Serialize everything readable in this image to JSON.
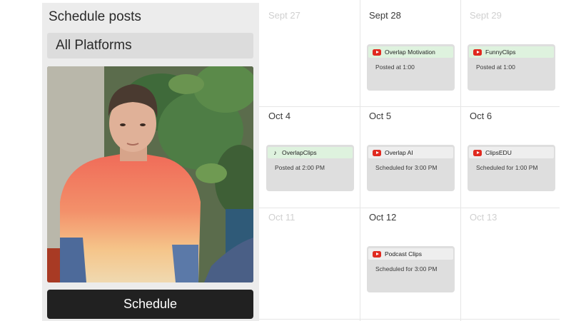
{
  "panel": {
    "title": "Schedule posts",
    "platform_select": "All Platforms",
    "schedule_button": "Schedule"
  },
  "calendar": {
    "days": [
      {
        "label": "Sept 27",
        "muted": true,
        "posts": []
      },
      {
        "label": "Sept 28",
        "muted": false,
        "posts": [
          {
            "platform_icon": "youtube-icon",
            "name": "Overlap Motivation",
            "status": "Posted at 1:00",
            "header_color": "#def2de"
          }
        ]
      },
      {
        "label": "Sept 29",
        "muted": true,
        "posts": [
          {
            "platform_icon": "youtube-icon",
            "name": "FunnyClips",
            "status": "Posted at 1:00",
            "header_color": "#def2de"
          }
        ]
      },
      {
        "label": "Oct 4",
        "muted": false,
        "posts": [
          {
            "platform_icon": "tiktok-icon",
            "name": "OverlapClips",
            "status": "Posted at 2:00 PM",
            "header_color": "#def2de"
          }
        ]
      },
      {
        "label": "Oct 5",
        "muted": false,
        "posts": [
          {
            "platform_icon": "youtube-icon",
            "name": "Overlap AI",
            "status": "Scheduled for 3:00 PM",
            "header_color": "#eeeeee"
          }
        ]
      },
      {
        "label": "Oct 6",
        "muted": false,
        "posts": [
          {
            "platform_icon": "youtube-icon",
            "name": "ClipsEDU",
            "status": "Scheduled for 1:00 PM",
            "header_color": "#eeeeee"
          }
        ]
      },
      {
        "label": "Oct 11",
        "muted": true,
        "posts": []
      },
      {
        "label": "Oct 12",
        "muted": false,
        "posts": [
          {
            "platform_icon": "youtube-icon",
            "name": "Podcast Clips",
            "status": "Scheduled for 3:00 PM",
            "header_color": "#eeeeee"
          }
        ]
      },
      {
        "label": "Oct 13",
        "muted": true,
        "posts": []
      }
    ]
  },
  "colors": {
    "youtube": "#e02a20",
    "posted_header": "#def2de",
    "scheduled_header": "#eeeeee",
    "button": "#212121"
  }
}
